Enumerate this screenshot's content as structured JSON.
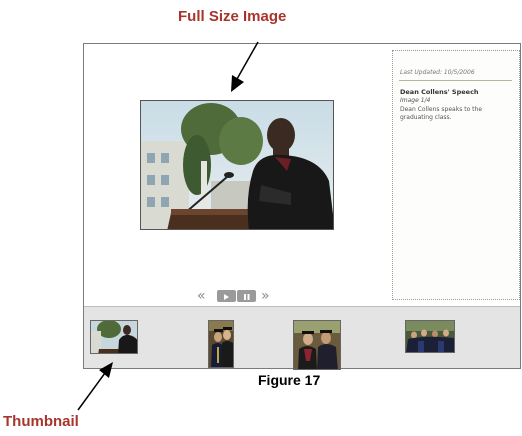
{
  "annotations": {
    "full_size_label": "Full Size Image",
    "thumbnail_label": "Thumbnail",
    "figure_caption": "Figure 17"
  },
  "viewer": {
    "last_updated": "Last Updated: 10/5/2006",
    "image_title": "Dean Collens' Speech",
    "image_count": "Image 1/4",
    "image_caption": "Dean Collens speaks to the graduating class.",
    "controls": {
      "prev": "«",
      "next": "»"
    },
    "thumbnails": [
      {
        "subject": "speaker at podium"
      },
      {
        "subject": "two graduates"
      },
      {
        "subject": "group of graduates"
      },
      {
        "subject": "crowd of graduates"
      }
    ]
  },
  "colors": {
    "label_red": "#a8352c",
    "strip_bg": "#e4e4e4",
    "control_gray": "#9a9a9a"
  }
}
